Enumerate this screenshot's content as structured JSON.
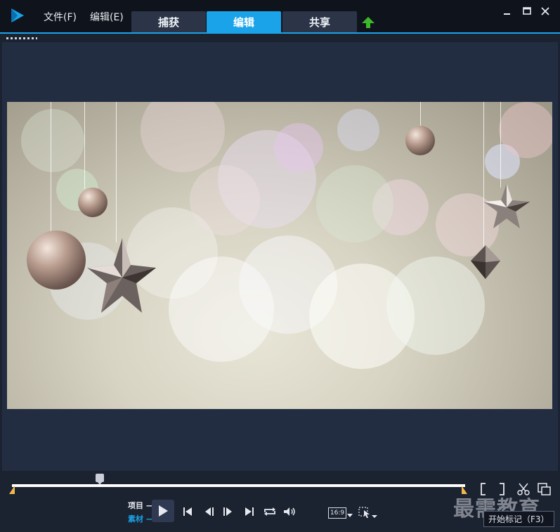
{
  "app": {
    "logo_icon": "video-editor-logo-icon"
  },
  "menu": {
    "file": "文件(F)",
    "edit": "编辑(E)"
  },
  "tabs": [
    {
      "label": "捕获",
      "active": false
    },
    {
      "label": "编辑",
      "active": true
    },
    {
      "label": "共享",
      "active": false
    }
  ],
  "window_controls": {
    "minimize_icon": "minimize-icon",
    "maximize_icon": "maximize-icon",
    "close_icon": "close-icon"
  },
  "upload_icon": "upload-arrow-icon",
  "player": {
    "mode_project": "项目",
    "mode_clip": "素材",
    "active_mode": "clip",
    "aspect_ratio": "16:9",
    "tooltip": "开始标记（F3）",
    "controls": [
      "play-icon",
      "go-to-start-icon",
      "previous-frame-icon",
      "next-frame-icon",
      "go-to-end-icon",
      "repeat-icon",
      "volume-icon"
    ],
    "right_tools": [
      "trim-bracket-icon",
      "scissors-icon",
      "copy-snapshot-icon",
      "pointer-select-icon"
    ]
  },
  "watermark": "最需教育",
  "colors": {
    "accent": "#1aa3e8",
    "background": "#232d42",
    "marker": "#f2b84b",
    "upload_green": "#3db82a"
  }
}
